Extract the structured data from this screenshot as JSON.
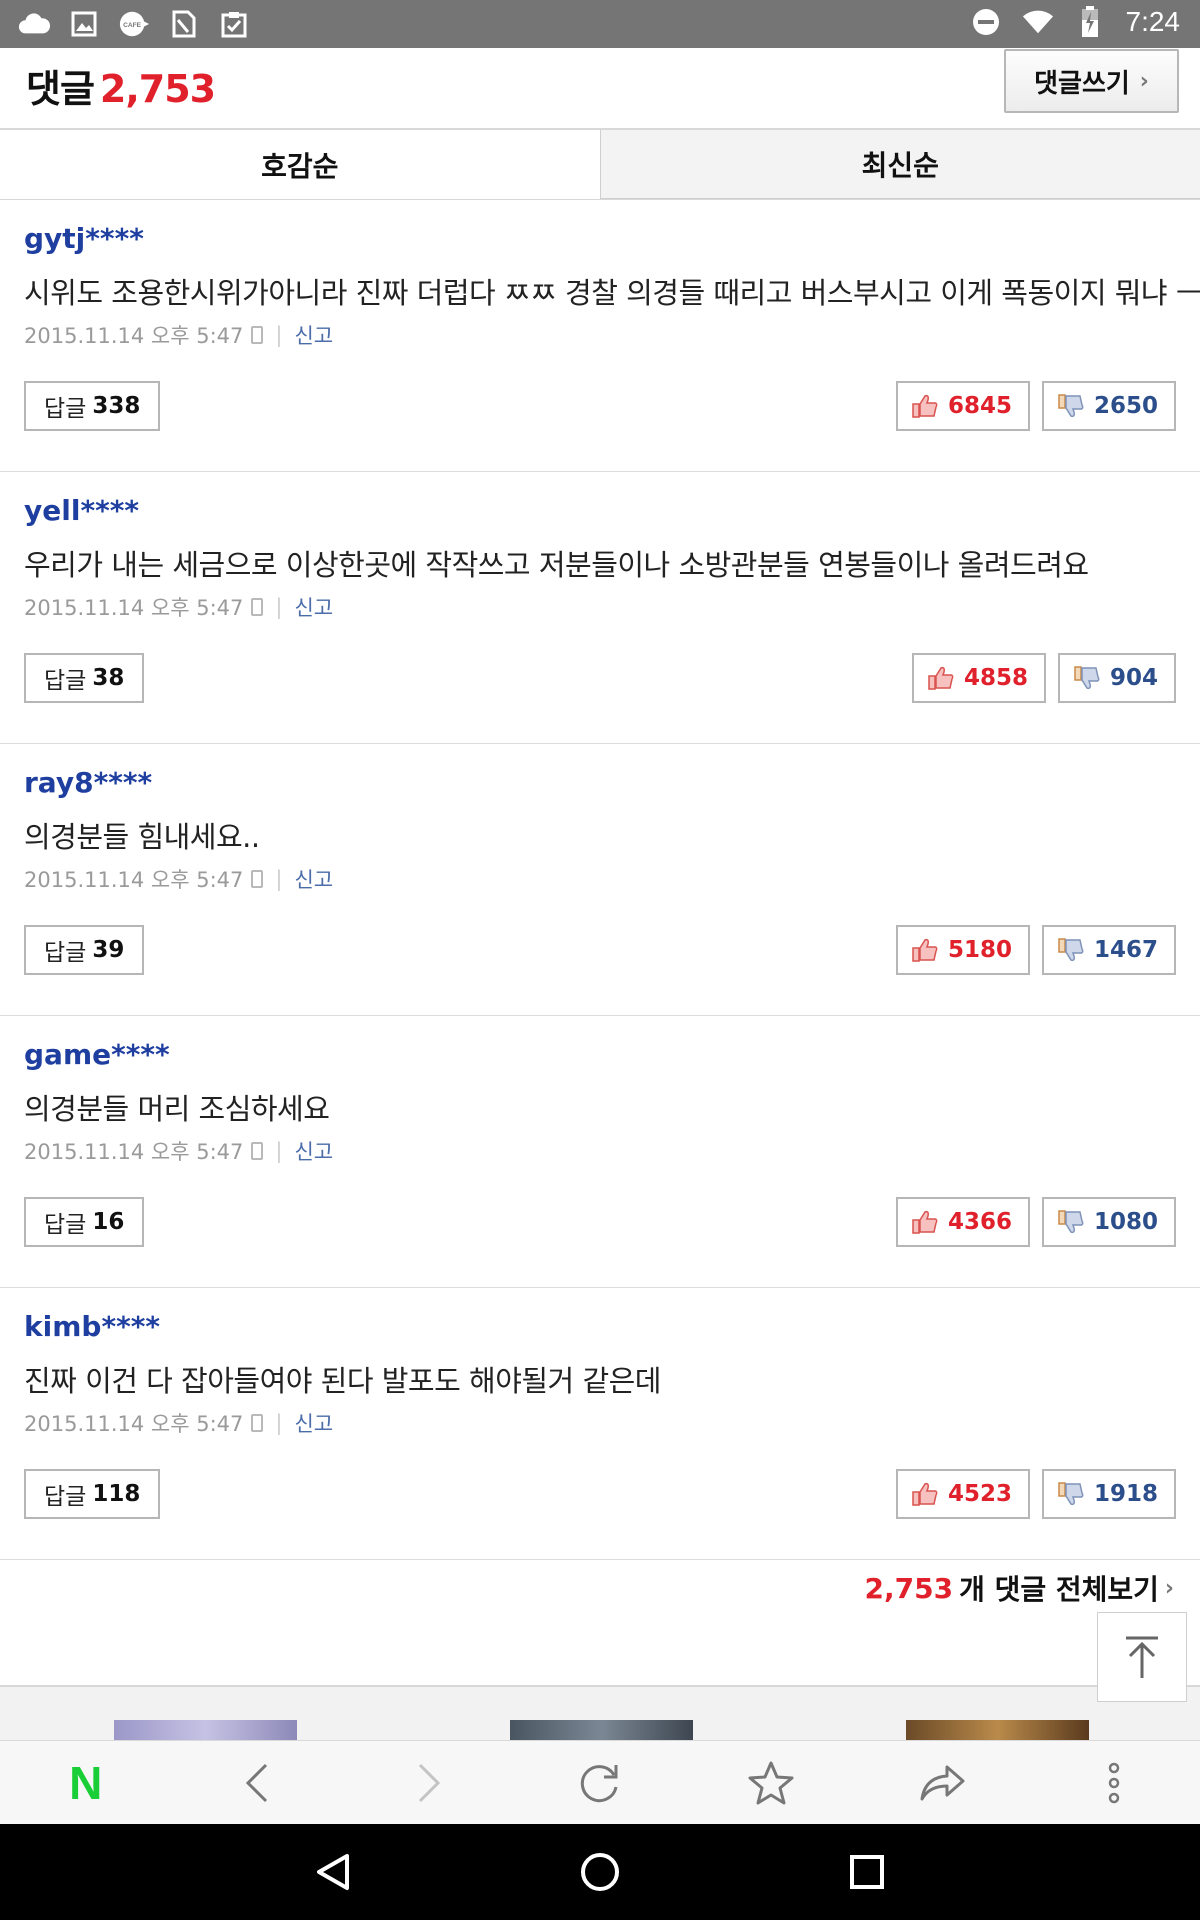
{
  "status_bar": {
    "time": "7:24",
    "left_icons": [
      "cloud-icon",
      "image-icon",
      "cafe-icon",
      "sim-icon",
      "clipboard-icon"
    ],
    "right_icons": [
      "dnd-icon",
      "wifi-icon",
      "battery-icon"
    ]
  },
  "header": {
    "title": "댓글",
    "count": "2,753",
    "write_button": "댓글쓰기",
    "write_chevron": "›"
  },
  "tabs": [
    {
      "label": "호감순",
      "active": true
    },
    {
      "label": "최신순",
      "active": false
    }
  ],
  "comments": [
    {
      "user": "gytj****",
      "text": "시위도 조용한시위가아니라 진짜 더럽다 ㅉㅉ 경찰 의경들 때리고 버스부시고 이게 폭동이지 뭐냐 ㅡㅡ",
      "date": "2015.11.14 오후 5:47",
      "report": "신고",
      "reply_label": "답글",
      "reply_count": "338",
      "likes": "6845",
      "dislikes": "2650"
    },
    {
      "user": "yell****",
      "text": "우리가 내는 세금으로 이상한곳에 작작쓰고 저분들이나 소방관분들 연봉들이나 올려드려요",
      "date": "2015.11.14 오후 5:47",
      "report": "신고",
      "reply_label": "답글",
      "reply_count": "38",
      "likes": "4858",
      "dislikes": "904"
    },
    {
      "user": "ray8****",
      "text": "의경분들 힘내세요..",
      "date": "2015.11.14 오후 5:47",
      "report": "신고",
      "reply_label": "답글",
      "reply_count": "39",
      "likes": "5180",
      "dislikes": "1467"
    },
    {
      "user": "game****",
      "text": "의경분들 머리 조심하세요",
      "date": "2015.11.14 오후 5:47",
      "report": "신고",
      "reply_label": "답글",
      "reply_count": "16",
      "likes": "4366",
      "dislikes": "1080"
    },
    {
      "user": "kimb****",
      "text": "진짜 이건 다 잡아들여야 된다 발포도 해야될거 같은데",
      "date": "2015.11.14 오후 5:47",
      "report": "신고",
      "reply_label": "답글",
      "reply_count": "118",
      "likes": "4523",
      "dislikes": "1918"
    }
  ],
  "view_all": {
    "count": "2,753",
    "label": "개 댓글 전체보기",
    "chevron": "›"
  },
  "toolbar": {
    "logo": "N",
    "icons": [
      "back-icon",
      "forward-icon",
      "refresh-icon",
      "bookmark-star-icon",
      "share-icon",
      "more-icon"
    ]
  },
  "nav_bar": {
    "icons": [
      "nav-back-icon",
      "nav-home-icon",
      "nav-recents-icon"
    ]
  },
  "colors": {
    "accent_red": "#e0202a",
    "username_blue": "#1f3fa0",
    "naver_green": "#19ce36"
  }
}
